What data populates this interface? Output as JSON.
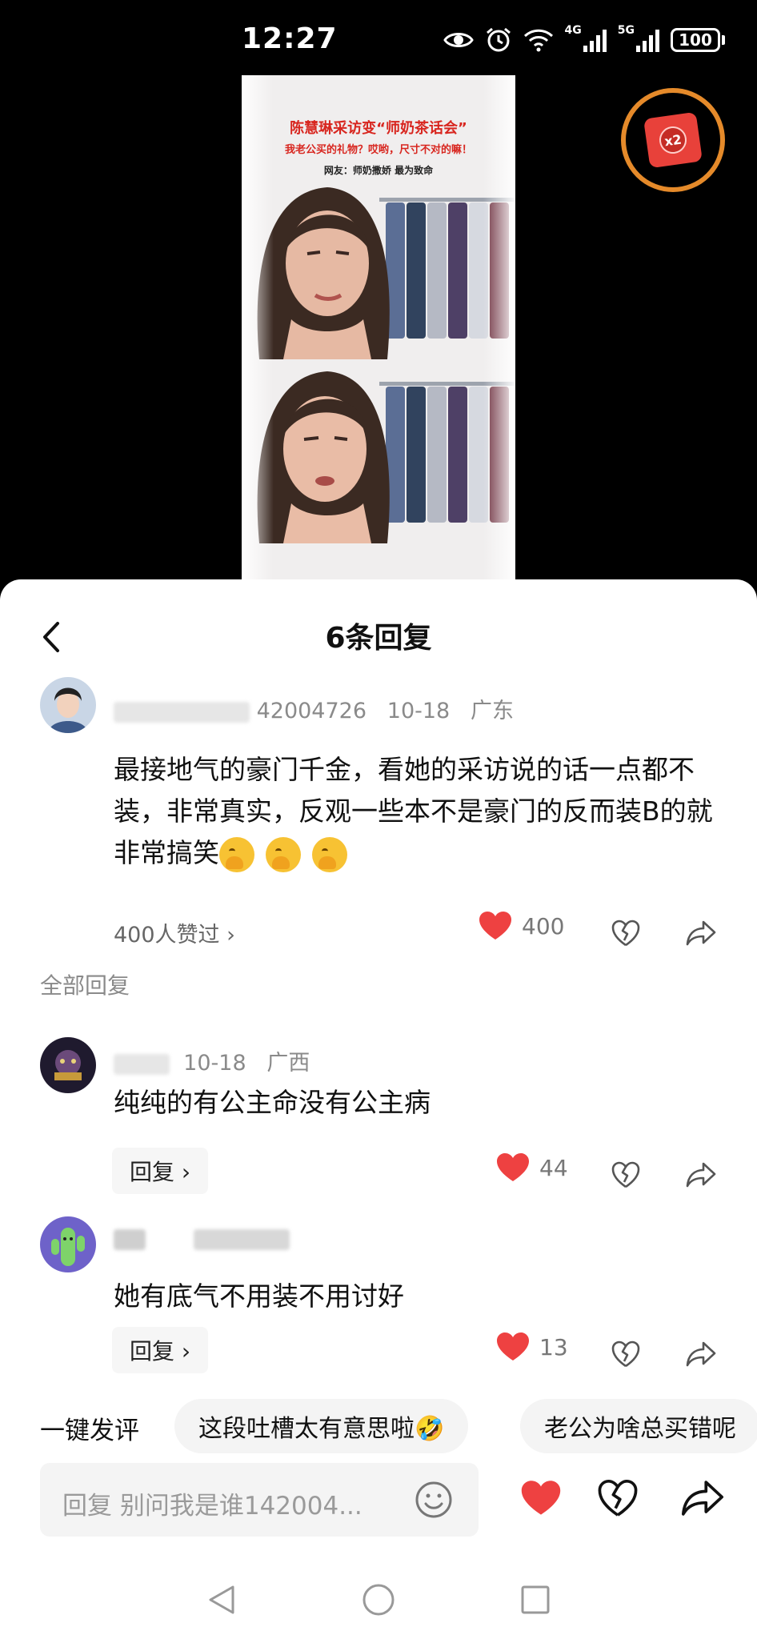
{
  "status_bar": {
    "time": "12:27",
    "network_1": "4G",
    "network_2": "5G",
    "battery": "100"
  },
  "video": {
    "title": "陈慧琳采访变“师奶茶话会”",
    "subtitle": "我老公买的礼物？哎哟，尺寸不对的嘛！",
    "subtitle2": "网友：师奶撒娇 最为致命"
  },
  "sheet": {
    "title": "6条回复"
  },
  "main_comment": {
    "username_visible": "42004726",
    "date": "10-18",
    "location": "广东",
    "text": "最接地气的豪门千金，看她的采访说的话一点都不装，非常真实，反观一些本不是豪门的反而装B的就非常搞笑",
    "likes_link": "400人赞过 ›",
    "like_count": "400"
  },
  "section_label": "全部回复",
  "replies": [
    {
      "date": "10-18",
      "location": "广西",
      "text": "纯纯的有公主命没有公主病",
      "reply_label": "回复 ›",
      "like_count": "44"
    },
    {
      "date": "",
      "location": "",
      "text": "她有底气不用装不用讨好",
      "reply_label": "回复 ›",
      "like_count": "13"
    }
  ],
  "quick_comment": {
    "label": "一键发评",
    "chips": [
      "这段吐槽太有意思啦🤣",
      "老公为啥总买错呢"
    ]
  },
  "input": {
    "placeholder": "回复 别问我是谁142004..."
  },
  "colors": {
    "like_red": "#ee4141",
    "sheet_bg": "#ffffff",
    "reward_orange": "#e58a2a"
  },
  "icons": [
    "eye-icon",
    "alarm-icon",
    "wifi-icon",
    "signal-icon",
    "battery-icon",
    "red-packet-icon",
    "back-icon",
    "heart-icon",
    "broken-heart-icon",
    "share-icon",
    "smile-icon",
    "nav-back-icon",
    "nav-home-icon",
    "nav-recents-icon"
  ]
}
